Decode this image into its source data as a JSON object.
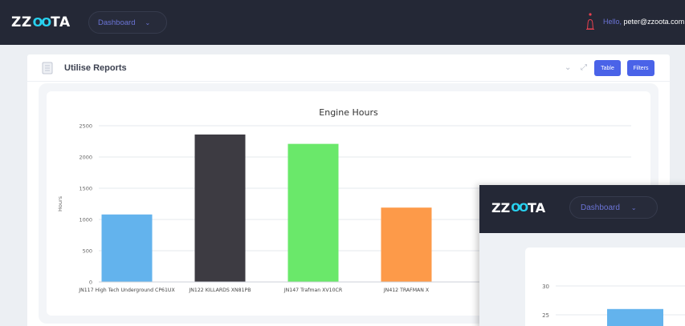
{
  "header": {
    "logo_left": "ZZ",
    "logo_mid": "OO",
    "logo_right": "TA",
    "dashboard_label": "Dashboard",
    "hello_text": "Hello, ",
    "user_email": "peter@zzoota.com"
  },
  "card": {
    "title": "Utilise Reports",
    "table_button": "Table",
    "filters_button": "Filters"
  },
  "chart_data": [
    {
      "type": "bar",
      "title": "Engine Hours",
      "xlabel": "",
      "ylabel": "Hours",
      "ylim": [
        0,
        2500
      ],
      "yticks": [
        "0",
        "500",
        "1000",
        "1500",
        "2000",
        "2500"
      ],
      "categories": [
        "JN117 High Tech Underground CP61UX",
        "JN122 KILLARDS XN81PB",
        "JN147 Trafman XV10CR",
        "JN412 TRAFMAN X"
      ],
      "values": [
        1080,
        2360,
        2210,
        1190
      ],
      "colors": [
        "#63b3ed",
        "#3d3b42",
        "#6ae86a",
        "#fd9a49"
      ]
    },
    {
      "type": "bar",
      "title": "",
      "yticks": [
        "30",
        "25"
      ],
      "ylim_visible": [
        25,
        30
      ],
      "values": [
        26
      ],
      "colors": [
        "#63b3ed"
      ]
    }
  ],
  "overlay": {
    "logo_left": "ZZ",
    "logo_mid": "OO",
    "logo_right": "TA",
    "dashboard_label": "Dashboard"
  }
}
